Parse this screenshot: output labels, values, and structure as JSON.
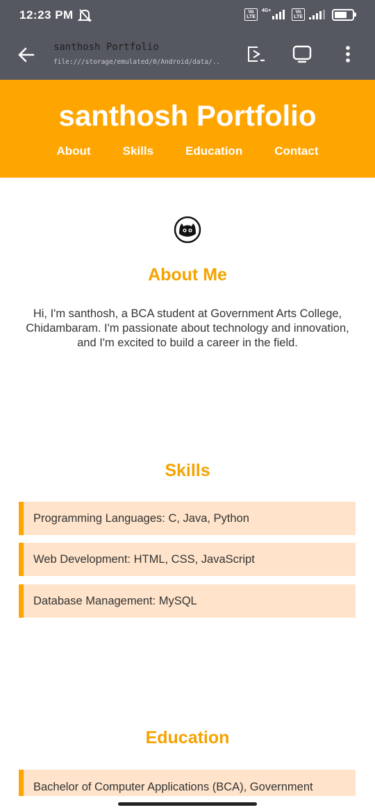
{
  "status_bar": {
    "time": "12:23 PM",
    "net_type": "4G+",
    "sim1_label": "Vo LTE",
    "sim2_label": "Vo LTE",
    "battery_percent": 70
  },
  "browser": {
    "page_title": "santhosh Portfolio",
    "url": "file:///storage/emulated/0/Android/data/..."
  },
  "header": {
    "title": "santhosh Portfolio",
    "nav": [
      "About",
      "Skills",
      "Education",
      "Contact"
    ]
  },
  "about": {
    "heading": "About Me",
    "text": "Hi, I'm santhosh, a BCA student at Government Arts College, Chidambaram. I'm passionate about technology and innovation, and I'm excited to build a career in the field."
  },
  "skills": {
    "heading": "Skills",
    "items": [
      "Programming Languages: C, Java, Python",
      "Web Development: HTML, CSS, JavaScript",
      "Database Management: MySQL"
    ]
  },
  "education": {
    "heading": "Education",
    "items": [
      "Bachelor of Computer Applications (BCA), Government"
    ]
  },
  "colors": {
    "accent": "#ffa500",
    "heading": "#f5a300",
    "item_bg": "#ffe4cb",
    "chrome": "#555861"
  }
}
